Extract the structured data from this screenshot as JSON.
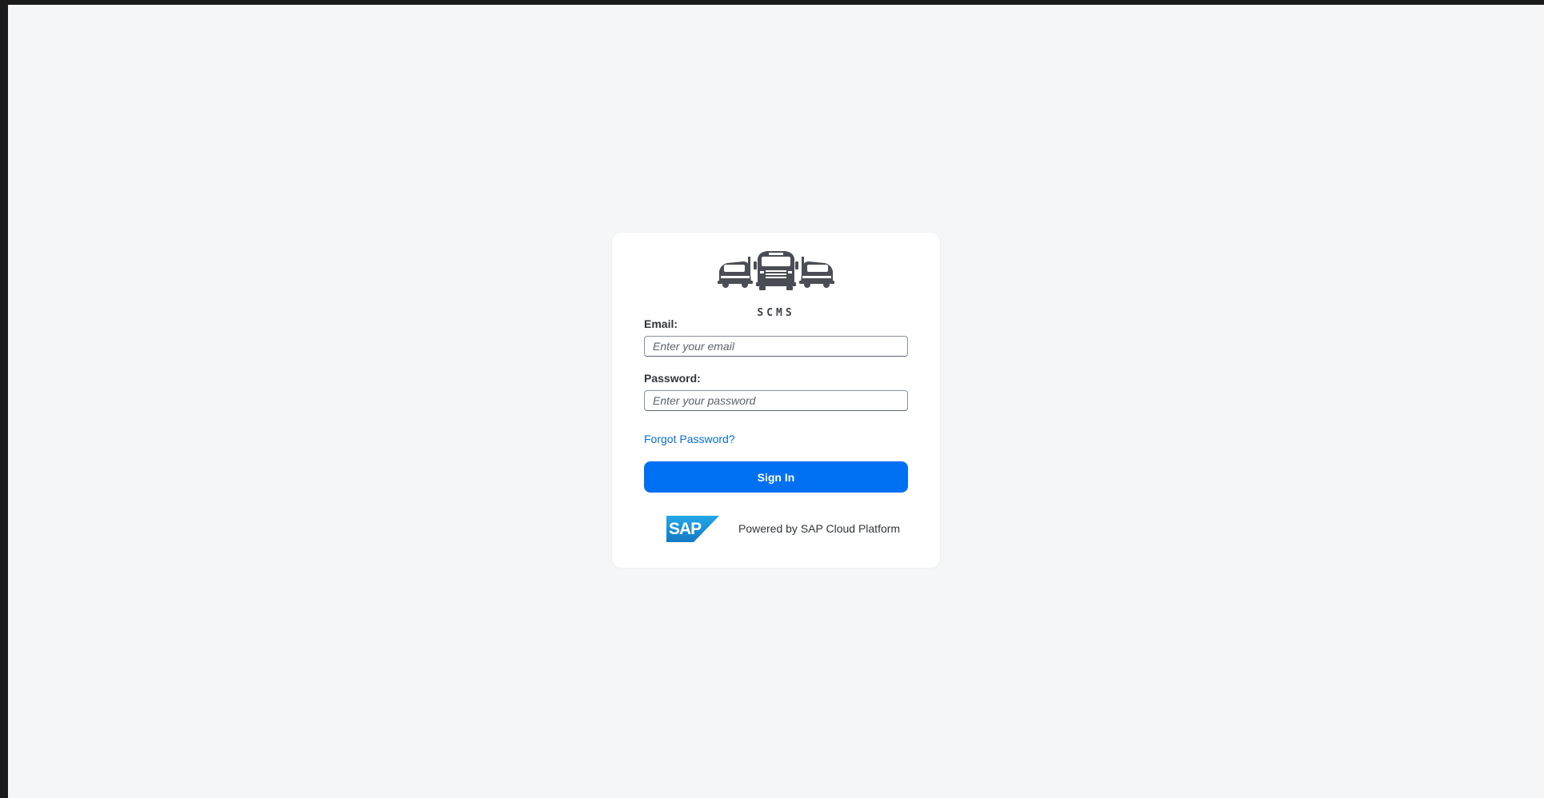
{
  "brand": {
    "logo_icon": "trucks-logo-icon",
    "name": "SCMS"
  },
  "login": {
    "email_label": "Email:",
    "email_placeholder": "Enter your email",
    "email_value": "",
    "password_label": "Password:",
    "password_placeholder": "Enter your password",
    "password_value": "",
    "forgot_link": "Forgot Password?",
    "signin_label": "Sign In"
  },
  "footer": {
    "logo_text": "SAP",
    "powered_text": "Powered by SAP Cloud Platform"
  },
  "colors": {
    "accent": "#0070f2",
    "link": "#0a6ed1",
    "page_background": "#f5f6f7",
    "sap_blue": "#1b8fd6"
  }
}
